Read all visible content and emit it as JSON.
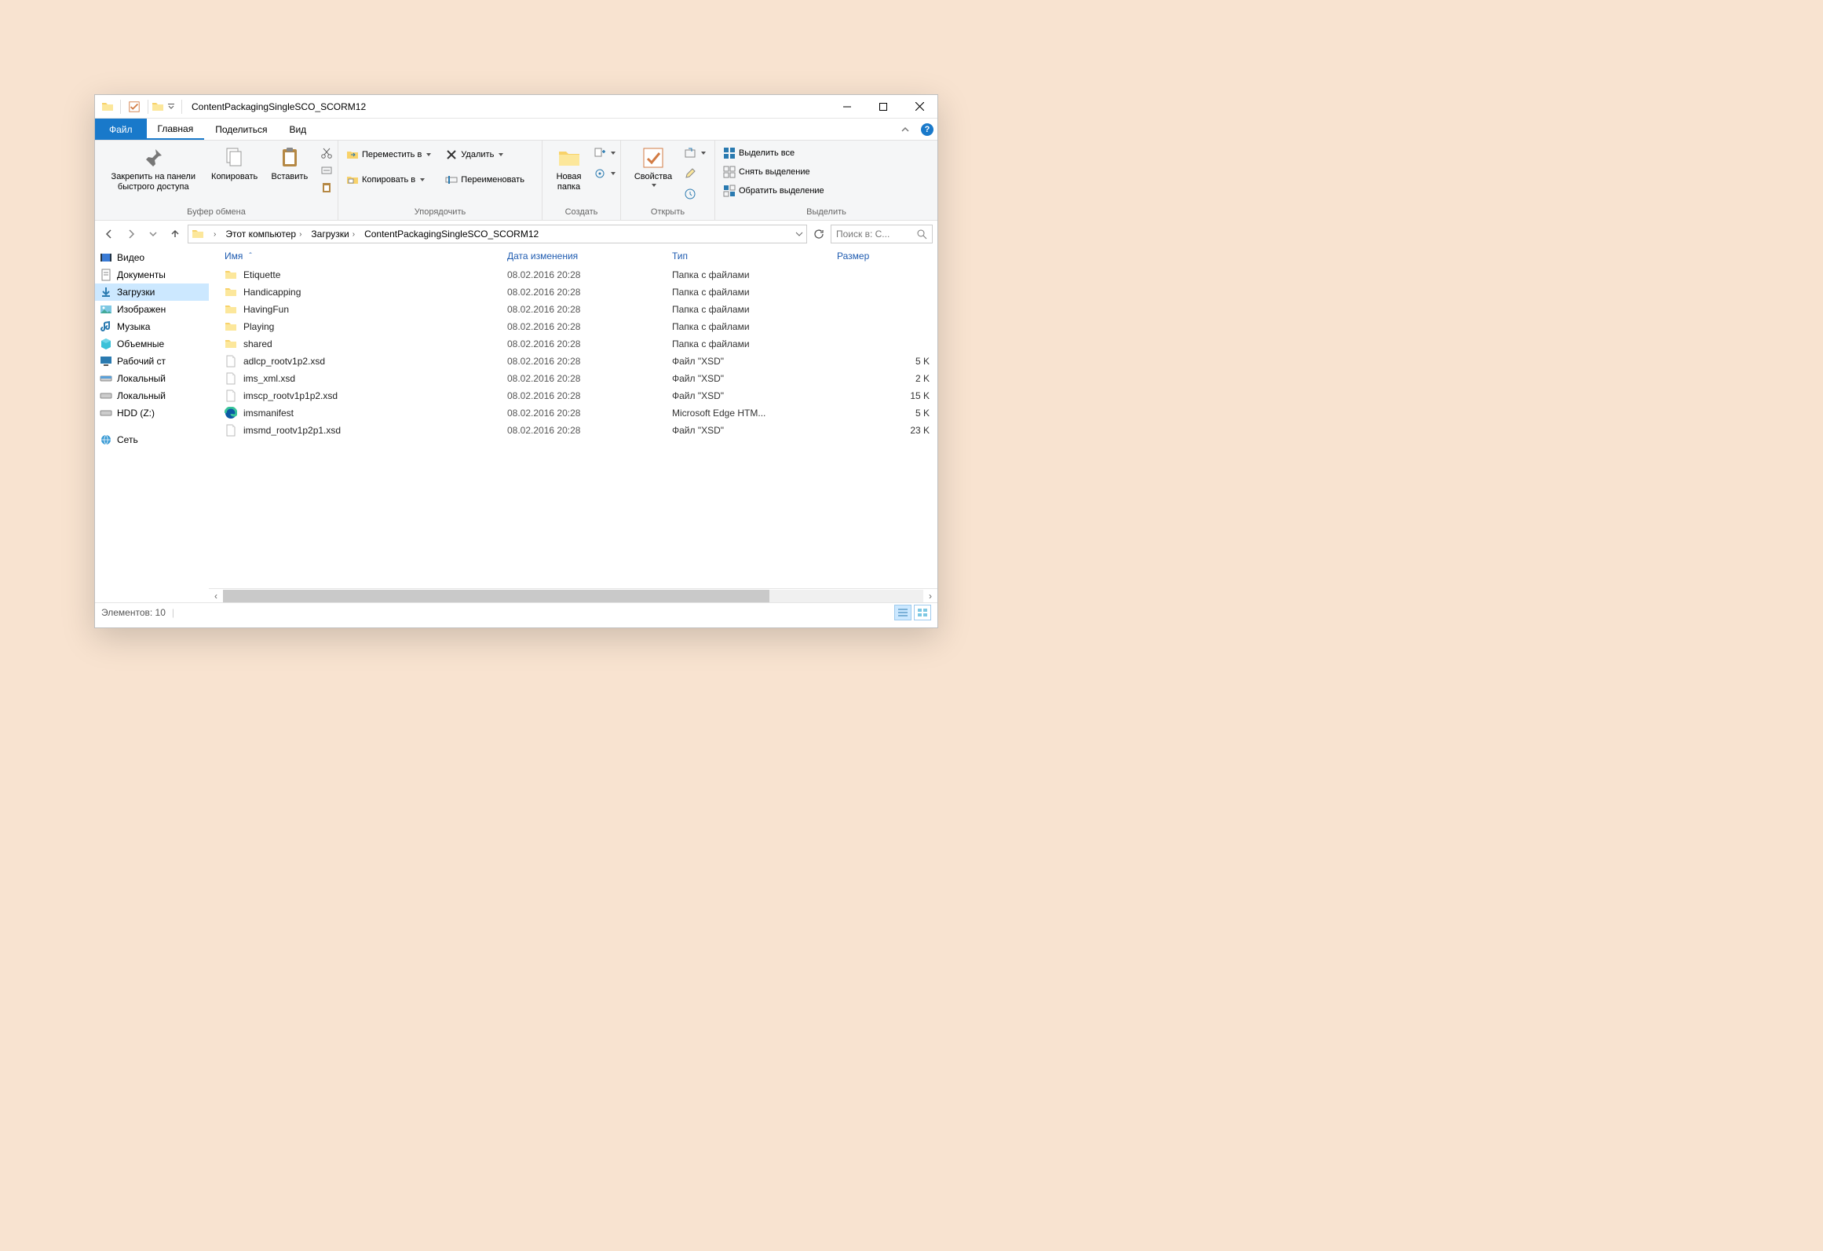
{
  "window": {
    "title": "ContentPackagingSingleSCO_SCORM12"
  },
  "ribbon_tabs": {
    "file": "Файл",
    "home": "Главная",
    "share": "Поделиться",
    "view": "Вид"
  },
  "ribbon": {
    "clipboard": {
      "pin": "Закрепить на панели быстрого доступа",
      "copy": "Копировать",
      "paste": "Вставить",
      "group": "Буфер обмена"
    },
    "organize": {
      "move_to": "Переместить в",
      "copy_to": "Копировать в",
      "delete": "Удалить",
      "rename": "Переименовать",
      "group": "Упорядочить"
    },
    "new": {
      "new_folder": "Новая папка",
      "group": "Создать"
    },
    "open": {
      "properties": "Свойства",
      "group": "Открыть"
    },
    "select": {
      "select_all": "Выделить все",
      "select_none": "Снять выделение",
      "invert": "Обратить выделение",
      "group": "Выделить"
    }
  },
  "breadcrumb": {
    "seg1": "Этот компьютер",
    "seg2": "Загрузки",
    "seg3": "ContentPackagingSingleSCO_SCORM12"
  },
  "search": {
    "placeholder": "Поиск в: C..."
  },
  "tree": {
    "video": "Видео",
    "documents": "Документы",
    "downloads": "Загрузки",
    "images": "Изображен",
    "music": "Музыка",
    "objects3d": "Объемные",
    "desktop": "Рабочий ст",
    "localdisk": "Локальный",
    "localdisk2": "Локальный",
    "hdd": "HDD (Z:)",
    "network": "Сеть"
  },
  "columns": {
    "name": "Имя",
    "date": "Дата изменения",
    "type": "Тип",
    "size": "Размер"
  },
  "files": [
    {
      "name": "Etiquette",
      "date": "08.02.2016 20:28",
      "type": "Папка с файлами",
      "size": "",
      "icon": "folder"
    },
    {
      "name": "Handicapping",
      "date": "08.02.2016 20:28",
      "type": "Папка с файлами",
      "size": "",
      "icon": "folder"
    },
    {
      "name": "HavingFun",
      "date": "08.02.2016 20:28",
      "type": "Папка с файлами",
      "size": "",
      "icon": "folder"
    },
    {
      "name": "Playing",
      "date": "08.02.2016 20:28",
      "type": "Папка с файлами",
      "size": "",
      "icon": "folder"
    },
    {
      "name": "shared",
      "date": "08.02.2016 20:28",
      "type": "Папка с файлами",
      "size": "",
      "icon": "folder"
    },
    {
      "name": "adlcp_rootv1p2.xsd",
      "date": "08.02.2016 20:28",
      "type": "Файл \"XSD\"",
      "size": "5 K",
      "icon": "file"
    },
    {
      "name": "ims_xml.xsd",
      "date": "08.02.2016 20:28",
      "type": "Файл \"XSD\"",
      "size": "2 K",
      "icon": "file"
    },
    {
      "name": "imscp_rootv1p1p2.xsd",
      "date": "08.02.2016 20:28",
      "type": "Файл \"XSD\"",
      "size": "15 K",
      "icon": "file"
    },
    {
      "name": "imsmanifest",
      "date": "08.02.2016 20:28",
      "type": "Microsoft Edge HTM...",
      "size": "5 K",
      "icon": "edge"
    },
    {
      "name": "imsmd_rootv1p2p1.xsd",
      "date": "08.02.2016 20:28",
      "type": "Файл \"XSD\"",
      "size": "23 K",
      "icon": "file"
    }
  ],
  "status": {
    "items": "Элементов: 10"
  }
}
